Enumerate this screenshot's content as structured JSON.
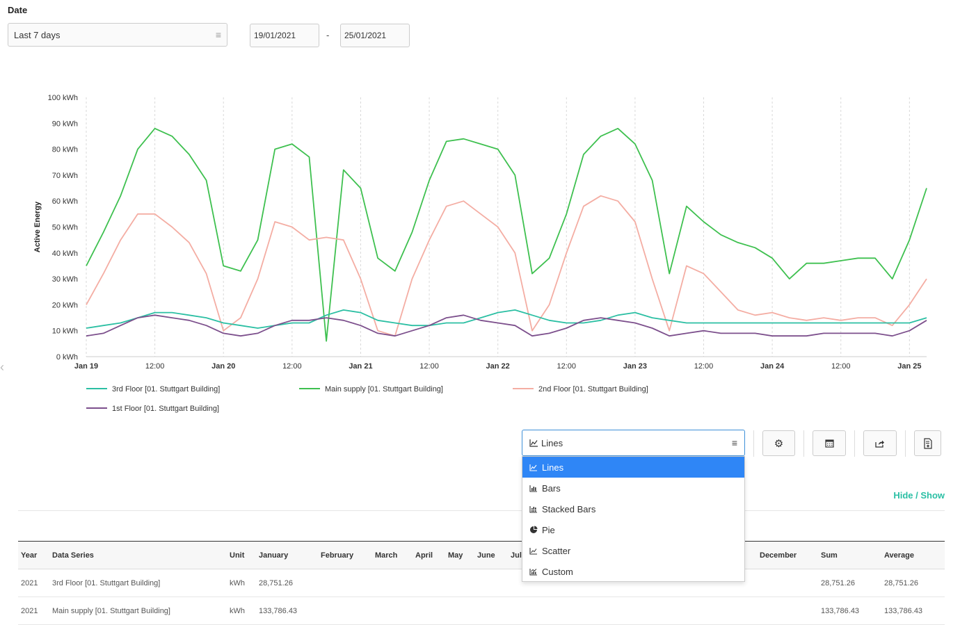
{
  "filter": {
    "date_label": "Date",
    "period": "Last 7 days",
    "from": "19/01/2021",
    "separator": "-",
    "to": "25/01/2021"
  },
  "chart_data": {
    "type": "line",
    "ylabel": "Active Energy",
    "unit": "kWh",
    "ylim": [
      0,
      100
    ],
    "yticks": [
      "0 kWh",
      "10 kWh",
      "20 kWh",
      "30 kWh",
      "40 kWh",
      "50 kWh",
      "60 kWh",
      "70 kWh",
      "80 kWh",
      "90 kWh",
      "100 kWh"
    ],
    "xticks": [
      "Jan 19",
      "12:00",
      "Jan 20",
      "12:00",
      "Jan 21",
      "12:00",
      "Jan 22",
      "12:00",
      "Jan 23",
      "12:00",
      "Jan 24",
      "12:00",
      "Jan 25"
    ],
    "x_start": "2021-01-19 00:00",
    "x_step_hours": 3,
    "grid": "vertical",
    "legend_position": "bottom",
    "series": [
      {
        "name": "3rd Floor [01. Stuttgart Building]",
        "color": "#2bbfa3",
        "values": [
          11,
          12,
          13,
          15,
          17,
          17,
          16,
          15,
          13,
          12,
          11,
          12,
          13,
          13,
          16,
          18,
          17,
          14,
          13,
          12,
          12,
          13,
          13,
          15,
          17,
          18,
          16,
          14,
          13,
          13,
          14,
          16,
          17,
          15,
          14,
          13,
          13,
          13,
          13,
          13,
          13,
          13,
          13,
          13,
          13,
          13,
          13,
          13,
          13,
          15
        ]
      },
      {
        "name": "Main supply [01. Stuttgart Building]",
        "color": "#3ec04f",
        "values": [
          35,
          48,
          62,
          80,
          88,
          85,
          78,
          68,
          35,
          33,
          45,
          80,
          82,
          77,
          6,
          72,
          65,
          38,
          33,
          48,
          68,
          83,
          84,
          82,
          80,
          70,
          32,
          38,
          55,
          78,
          85,
          88,
          82,
          68,
          32,
          58,
          52,
          47,
          44,
          42,
          38,
          30,
          36,
          36,
          37,
          38,
          38,
          30,
          45,
          65
        ]
      },
      {
        "name": "2nd Floor [01. Stuttgart Building]",
        "color": "#f4ada3",
        "values": [
          20,
          32,
          45,
          55,
          55,
          50,
          44,
          32,
          10,
          15,
          30,
          52,
          50,
          45,
          46,
          45,
          30,
          10,
          8,
          30,
          45,
          58,
          60,
          55,
          50,
          40,
          10,
          20,
          40,
          58,
          62,
          60,
          52,
          30,
          10,
          35,
          32,
          25,
          18,
          16,
          17,
          15,
          14,
          15,
          14,
          15,
          15,
          12,
          20,
          30
        ]
      },
      {
        "name": "1st Floor [01. Stuttgart Building]",
        "color": "#7c4f8c",
        "values": [
          8,
          9,
          12,
          15,
          16,
          15,
          14,
          12,
          9,
          8,
          9,
          12,
          14,
          14,
          15,
          14,
          12,
          9,
          8,
          10,
          12,
          15,
          16,
          14,
          13,
          12,
          8,
          9,
          11,
          14,
          15,
          14,
          13,
          11,
          8,
          9,
          10,
          9,
          9,
          9,
          8,
          8,
          8,
          9,
          9,
          9,
          9,
          8,
          10,
          14
        ]
      }
    ]
  },
  "toolbar": {
    "chart_type": "Lines",
    "options": [
      "Lines",
      "Bars",
      "Stacked Bars",
      "Pie",
      "Scatter",
      "Custom"
    ]
  },
  "section": {
    "hide_show": "Hide / Show"
  },
  "table": {
    "headers": [
      "Year",
      "Data Series",
      "Unit",
      "January",
      "February",
      "March",
      "April",
      "May",
      "June",
      "Jul",
      "December",
      "Sum",
      "Average"
    ],
    "rows": [
      [
        "2021",
        "3rd Floor [01. Stuttgart Building]",
        "kWh",
        "28,751.26",
        "28,751.26",
        "28,751.26"
      ],
      [
        "2021",
        "Main supply [01. Stuttgart Building]",
        "kWh",
        "133,786.43",
        "133,786.43",
        "133,786.43"
      ]
    ]
  }
}
